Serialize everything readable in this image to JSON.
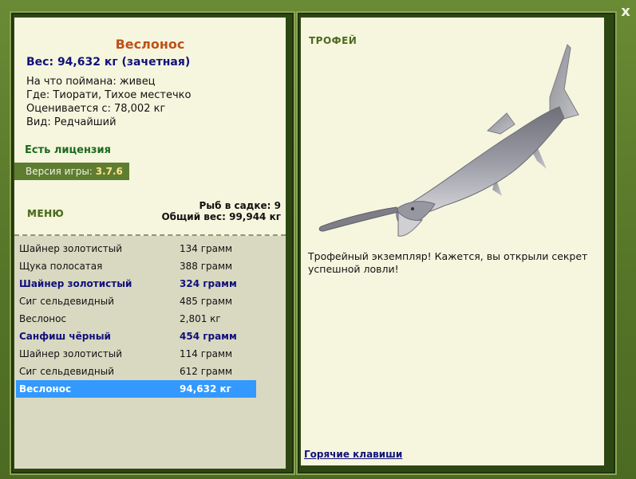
{
  "close_button": "x",
  "fish": {
    "name": "Веслонос",
    "weight": "Вес: 94,632 кг (зачетная)",
    "caught_on": "На что поймана: живец",
    "where": "Где: Тиорати, Тихое местечко",
    "rated_from": "Оценивается с: 78,002 кг",
    "type": "Вид: Редчайший"
  },
  "license": "Есть лицензия",
  "version": {
    "label": "Версия игры:",
    "value": "3.7.6"
  },
  "menu_title": "МЕНЮ",
  "keep": {
    "count": "Рыб в садке: 9",
    "total": "Общий вес: 99,944 кг"
  },
  "catch_list": [
    {
      "name": "Шайнер золотистый",
      "weight": "134 грамм",
      "bold": false,
      "selected": false
    },
    {
      "name": "Щука полосатая",
      "weight": "388 грамм",
      "bold": false,
      "selected": false
    },
    {
      "name": "Шайнер золотистый",
      "weight": "324 грамм",
      "bold": true,
      "selected": false
    },
    {
      "name": "Сиг сельдевидный",
      "weight": "485 грамм",
      "bold": false,
      "selected": false
    },
    {
      "name": "Веслонос",
      "weight": "2,801 кг",
      "bold": false,
      "selected": false
    },
    {
      "name": "Санфиш чёрный",
      "weight": "454 грамм",
      "bold": true,
      "selected": false
    },
    {
      "name": "Шайнер золотистый",
      "weight": "114 грамм",
      "bold": false,
      "selected": false
    },
    {
      "name": "Сиг сельдевидный",
      "weight": "612 грамм",
      "bold": false,
      "selected": false
    },
    {
      "name": "Веслонос",
      "weight": "94,632 кг",
      "bold": true,
      "selected": true
    }
  ],
  "trophy": {
    "title": "ТРОФЕЙ",
    "description": "Трофейный экземпляр! Кажется, вы открыли секрет успешной ловли!"
  },
  "hotkeys_link": "Горячие клавиши",
  "colors": {
    "background_green": "#5b7a2d",
    "panel_bg": "#f6f6df",
    "list_bg": "#d9d9c2",
    "selection_blue": "#3399ff",
    "fish_name_orange": "#c0501a",
    "navy_text": "#12127a"
  }
}
